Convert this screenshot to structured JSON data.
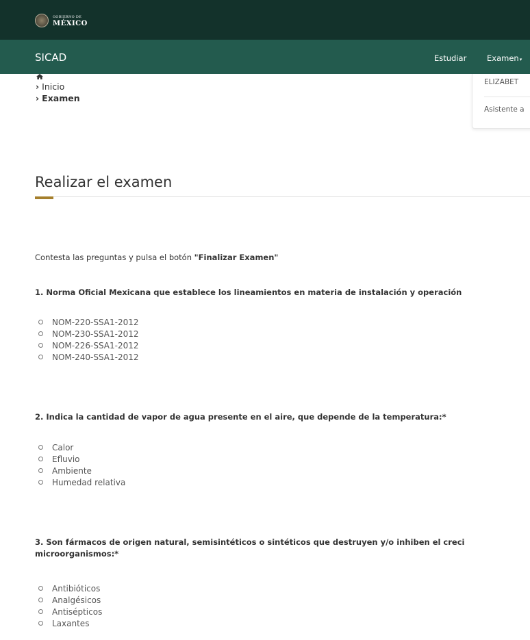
{
  "header": {
    "gob_small": "GOBIERNO DE",
    "gob_big": "MÉXICO"
  },
  "navbar": {
    "brand": "SICAD",
    "links": [
      "Estudiar",
      "Examen"
    ]
  },
  "breadcrumb": {
    "items": [
      "Inicio",
      "Examen"
    ]
  },
  "user_menu": {
    "name": "ELIZABET",
    "role": "Asistente a"
  },
  "page": {
    "title": "Realizar el examen",
    "intro_prefix": "Contesta las preguntas y pulsa el botón ",
    "intro_button_ref": "\"Finalizar Examen\""
  },
  "questions": [
    {
      "text": "1. Norma Oficial Mexicana que establece los lineamientos en materia de instalación y operación",
      "options": [
        "NOM-220-SSA1-2012",
        "NOM-230-SSA1-2012",
        "NOM-226-SSA1-2012",
        "NOM-240-SSA1-2012"
      ]
    },
    {
      "text": "2. Indica la cantidad de vapor de agua presente en el aire, que depende de la temperatura:*",
      "options": [
        "Calor",
        "Efluvio",
        "Ambiente",
        "Humedad relativa"
      ]
    },
    {
      "text_line1": "3. Son fármacos de origen natural, semisintéticos o sintéticos que destruyen y/o inhiben el creci",
      "text_line2": "microorganismos:*",
      "options": [
        "Antibióticos",
        "Analgésicos",
        "Antisépticos",
        "Laxantes"
      ]
    }
  ],
  "colors": {
    "topbar": "#13322b",
    "navbar": "#235b4e",
    "accent": "#a57f2c"
  }
}
